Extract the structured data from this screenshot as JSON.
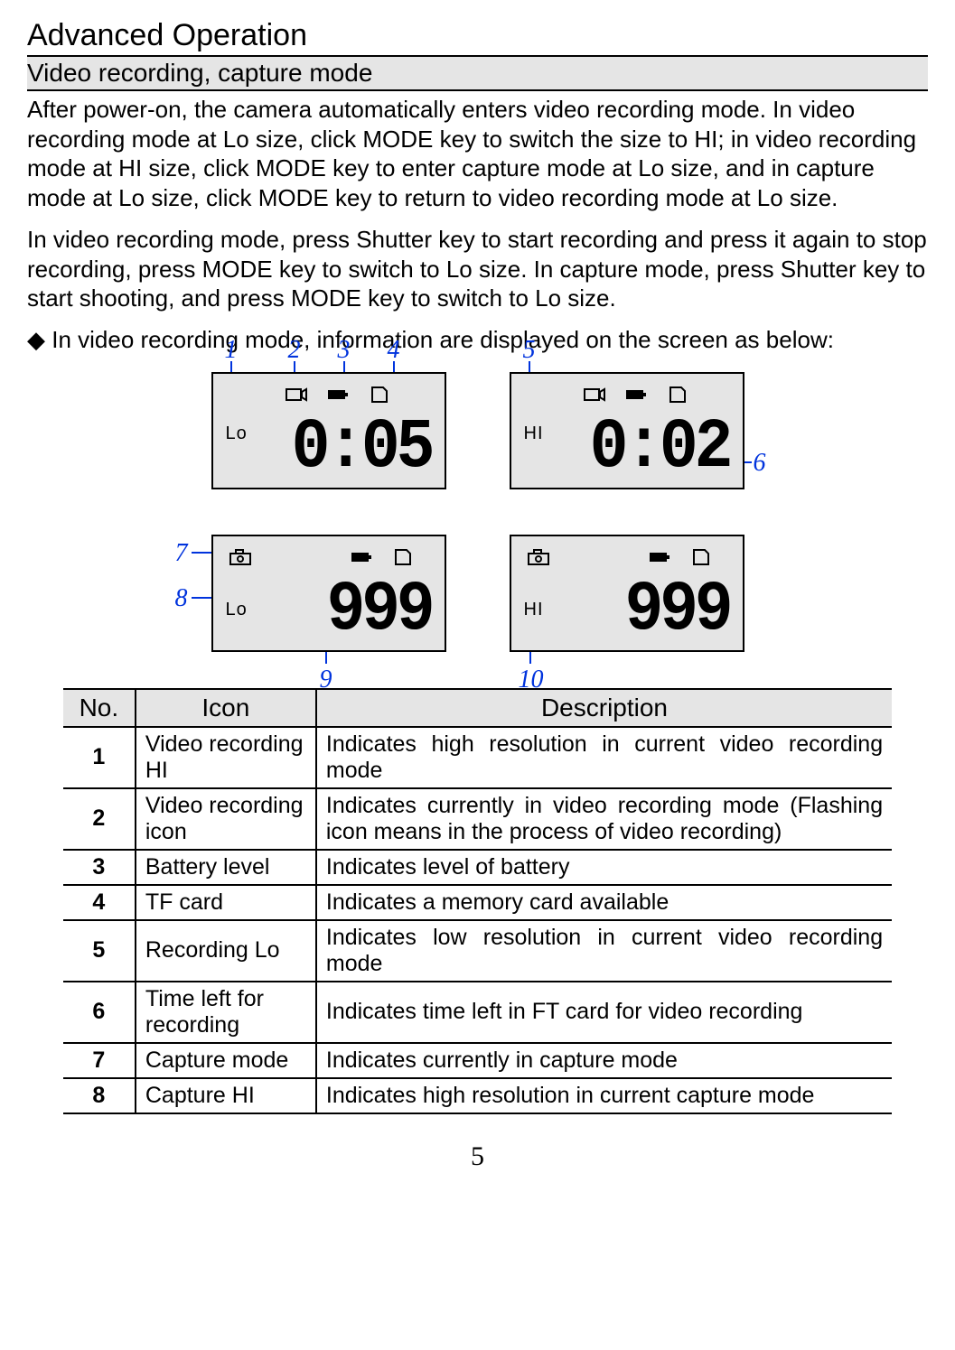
{
  "title": "Advanced Operation",
  "section_header": "Video recording, capture mode",
  "para1": "After power-on, the camera automatically enters video recording mode. In video recording mode at Lo size, click MODE key to switch the size to HI; in video recording mode at HI size, click MODE key to enter capture mode at Lo size, and in capture mode at Lo size, click MODE key to return to video recording mode at Lo size.",
  "para2": "In video recording mode, press Shutter key to start recording and press it again to stop recording, press MODE key to switch to Lo size. In capture mode, press Shutter key to start shooting, and press MODE key to switch to Lo size.",
  "bullet": "◆ In video recording mode, information are displayed on the screen as below:",
  "lcd": {
    "video_lo": {
      "size": "Lo",
      "digits": "0:05"
    },
    "video_hi": {
      "size": "HI",
      "digits": "0:02"
    },
    "cap_lo": {
      "size": "Lo",
      "digits": "999"
    },
    "cap_hi": {
      "size": "HI",
      "digits": "999"
    }
  },
  "callouts": {
    "c1": "1",
    "c2": "2",
    "c3": "3",
    "c4": "4",
    "c5": "5",
    "c6": "6",
    "c7": "7",
    "c8": "8",
    "c9": "9",
    "c10": "10"
  },
  "table": {
    "headers": {
      "no": "No.",
      "icon": "Icon",
      "desc": "Description"
    },
    "rows": [
      {
        "no": "1",
        "icon": "Video recording HI",
        "desc": "Indicates high resolution in current video recording mode"
      },
      {
        "no": "2",
        "icon": "Video recording icon",
        "desc": "Indicates currently in video recording mode (Flashing icon means in the process of video recording)"
      },
      {
        "no": "3",
        "icon": "Battery level",
        "desc": "Indicates level of battery"
      },
      {
        "no": "4",
        "icon": "TF card",
        "desc": "Indicates a memory card available"
      },
      {
        "no": "5",
        "icon": "Recording Lo",
        "desc": "Indicates  low resolution in current video recording mode"
      },
      {
        "no": "6",
        "icon": "Time left for recording",
        "desc": "Indicates time left in FT card for video  recording"
      },
      {
        "no": "7",
        "icon": "Capture mode",
        "desc": "Indicates currently in capture mode"
      },
      {
        "no": "8",
        "icon": "Capture HI",
        "desc": "Indicates high resolution in current capture mode"
      }
    ]
  },
  "page_number": "5"
}
